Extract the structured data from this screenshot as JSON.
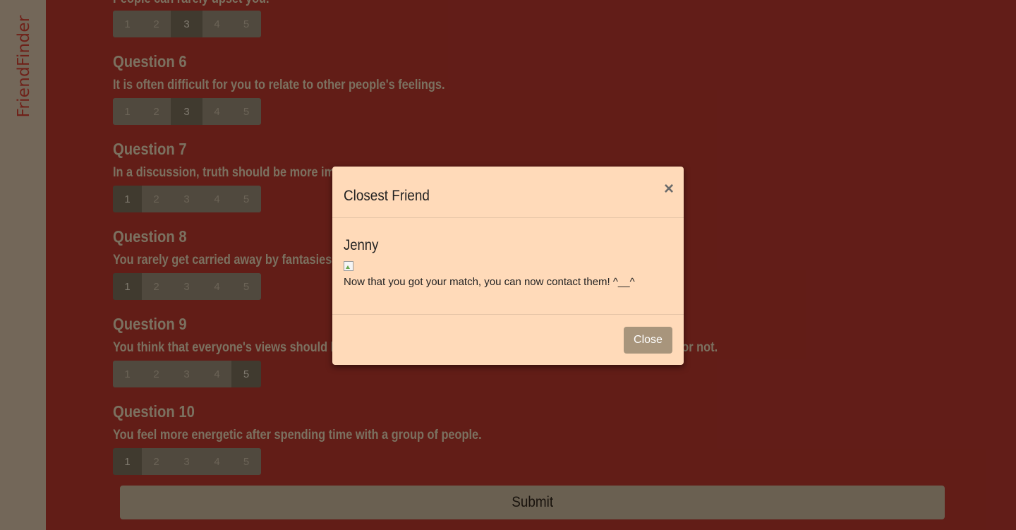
{
  "brand": "FriendFinder",
  "partial_question_text": "People can rarely upset you.",
  "questions": [
    {
      "title": "Question 6",
      "text": "It is often difficult for you to relate to other people's feelings.",
      "selected": 3
    },
    {
      "title": "Question 7",
      "text": "In a discussion, truth should be more important than people's sensitivities.",
      "selected": 1
    },
    {
      "title": "Question 8",
      "text": "You rarely get carried away by fantasies and ideas.",
      "selected": 1
    },
    {
      "title": "Question 9",
      "text": "You think that everyone's views should be respected regardless of whether they are supported by facts or not.",
      "selected": 5
    },
    {
      "title": "Question 10",
      "text": "You feel more energetic after spending time with a group of people.",
      "selected": 1
    }
  ],
  "option_labels": [
    "1",
    "2",
    "3",
    "4",
    "5"
  ],
  "partial_question_selected": 3,
  "submit_label": "Submit",
  "modal": {
    "title": "Closest Friend",
    "close_symbol": "×",
    "friend_name": "Jenny",
    "message": "Now that you got your match, you can now contact them! ^__^",
    "close_label": "Close"
  },
  "colors": {
    "page_background": "#a93229",
    "sidebar": "#c7b299",
    "brand_text": "#c0392b",
    "modal_background": "#ffdab9",
    "button": "#b7a58c"
  }
}
